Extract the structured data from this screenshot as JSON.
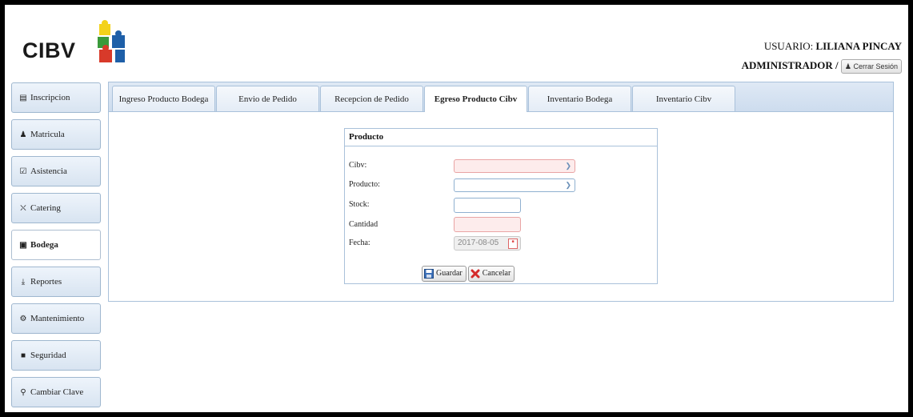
{
  "brand": {
    "logo_text": "CIBV"
  },
  "user": {
    "user_label": "USUARIO:",
    "user_name": "LILIANA PINCAY",
    "role": "ADMINISTRADOR /",
    "logout_label": "Cerrar Sesión"
  },
  "sidebar": {
    "items": [
      {
        "label": "Inscripcion",
        "icon": "list-icon"
      },
      {
        "label": "Matricula",
        "icon": "users-icon"
      },
      {
        "label": "Asistencia",
        "icon": "check-square-icon"
      },
      {
        "label": "Catering",
        "icon": "cutlery-icon"
      },
      {
        "label": "Bodega",
        "icon": "box-icon"
      },
      {
        "label": "Reportes",
        "icon": "download-icon"
      },
      {
        "label": "Mantenimiento",
        "icon": "gears-icon"
      },
      {
        "label": "Seguridad",
        "icon": "lock-icon"
      },
      {
        "label": "Cambiar Clave",
        "icon": "key-icon"
      }
    ]
  },
  "tabs": [
    {
      "label": "Ingreso Producto Bodega"
    },
    {
      "label": "Envio de Pedido"
    },
    {
      "label": "Recepcion de Pedido"
    },
    {
      "label": "Egreso Producto Cibv"
    },
    {
      "label": "Inventario Bodega"
    },
    {
      "label": "Inventario Cibv"
    }
  ],
  "form": {
    "title": "Producto",
    "cibv_label": "Cibv:",
    "producto_label": "Producto:",
    "stock_label": "Stock:",
    "cantidad_label": "Cantidad",
    "fecha_label": "Fecha:",
    "fecha_value": "2017-08-05",
    "save_label": "Guardar",
    "cancel_label": "Cancelar"
  },
  "colors": {
    "accent": "#a9c1da",
    "error_fill": "#fdecec",
    "error_border": "#e9a4a4"
  }
}
